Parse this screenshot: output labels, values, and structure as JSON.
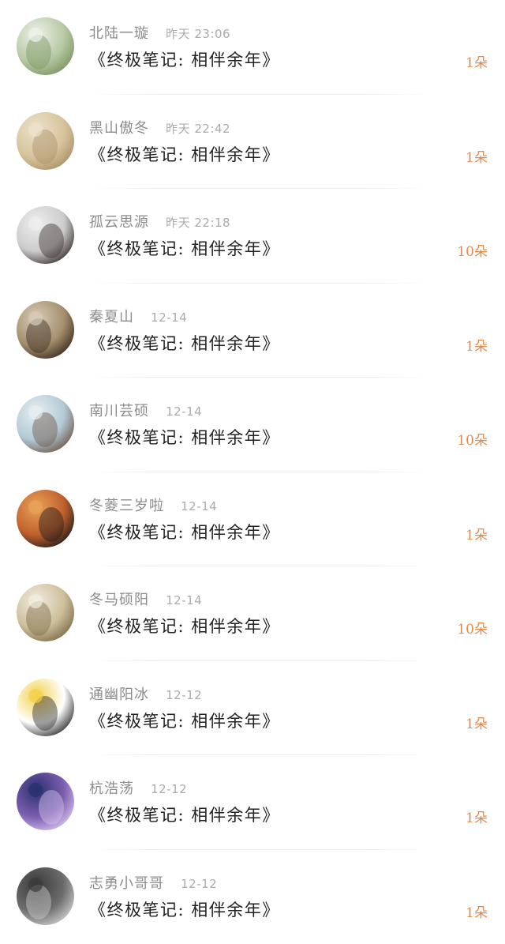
{
  "items": [
    {
      "username": "北陆一璇",
      "time": "昨天 23:06",
      "message": "《终极笔记: 相伴余年》",
      "count": "1朵",
      "avatar_icon": "flower-photo-icon",
      "avatar_colors": [
        "#eef2ea",
        "#b7c9a5",
        "#7a9460"
      ]
    },
    {
      "username": "黑山傲冬",
      "time": "昨天 22:42",
      "message": "《终极笔记: 相伴余年》",
      "count": "1朵",
      "avatar_icon": "dried-flower-photo-icon",
      "avatar_colors": [
        "#ece2cc",
        "#d8c49c",
        "#a89068"
      ]
    },
    {
      "username": "孤云思源",
      "time": "昨天 22:18",
      "message": "《终极笔记: 相伴余年》",
      "count": "10朵",
      "avatar_icon": "woman-portrait-icon",
      "avatar_colors": [
        "#eeeeee",
        "#cccccc",
        "#3b3030"
      ]
    },
    {
      "username": "秦夏山",
      "time": "12-14",
      "message": "《终极笔记: 相伴余年》",
      "count": "1朵",
      "avatar_icon": "anime-character-icon",
      "avatar_colors": [
        "#d8ccb8",
        "#a48f6e",
        "#3a2a1e"
      ]
    },
    {
      "username": "南川芸硕",
      "time": "12-14",
      "message": "《终极笔记: 相伴余年》",
      "count": "10朵",
      "avatar_icon": "girl-camera-photo-icon",
      "avatar_colors": [
        "#e7eef2",
        "#b3cad6",
        "#6d5548"
      ]
    },
    {
      "username": "冬菱三岁啦",
      "time": "12-14",
      "message": "《终极笔记: 相伴余年》",
      "count": "1朵",
      "avatar_icon": "girl-portrait-icon",
      "avatar_colors": [
        "#e9a25a",
        "#c0602c",
        "#1f1a1a"
      ]
    },
    {
      "username": "冬马硕阳",
      "time": "12-14",
      "message": "《终极笔记: 相伴余年》",
      "count": "10朵",
      "avatar_icon": "anime-warrior-icon",
      "avatar_colors": [
        "#f1ece0",
        "#cdbf9a",
        "#7d6a48"
      ]
    },
    {
      "username": "通幽阳冰",
      "time": "12-12",
      "message": "《终极笔记: 相伴余年》",
      "count": "1朵",
      "avatar_icon": "cat-photo-icon",
      "avatar_colors": [
        "#f2d14a",
        "#ffffff",
        "#2d2a2a"
      ]
    },
    {
      "username": "杭浩荡",
      "time": "12-12",
      "message": "《终极笔记: 相伴余年》",
      "count": "1朵",
      "avatar_icon": "fantasy-character-icon",
      "avatar_colors": [
        "#2a2f6e",
        "#7d5fb0",
        "#d7c6ef"
      ]
    },
    {
      "username": "志勇小哥哥",
      "time": "12-12",
      "message": "《终极笔记: 相伴余年》",
      "count": "1朵",
      "avatar_icon": "text-image-icon",
      "avatar_colors": [
        "#3a3a3a",
        "#6d6d6d",
        "#cfcfcf"
      ]
    }
  ]
}
